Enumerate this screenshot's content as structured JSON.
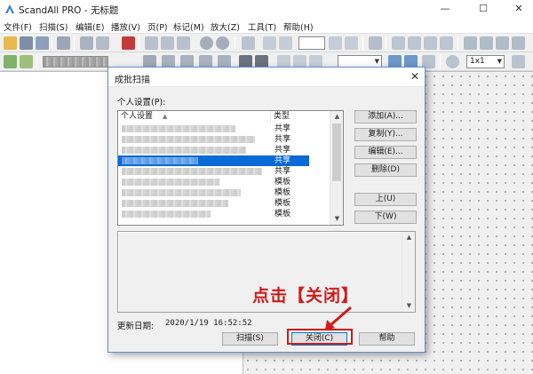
{
  "app": {
    "title": "ScandAll PRO - 无标题",
    "window_controls": {
      "minimize": "—",
      "maximize": "☐",
      "close": "✕"
    }
  },
  "menu": [
    "文件(F)",
    "扫描(S)",
    "编辑(E)",
    "播放(V)",
    "页(P)",
    "标记(M)",
    "放大(Z)",
    "工具(T)",
    "帮助(H)"
  ],
  "toolbar": {
    "zoom_value": "1x1"
  },
  "dialog": {
    "title": "成批扫描",
    "close_glyph": "✕",
    "settings_label": "个人设置(P):",
    "columns": {
      "name": "个人设置",
      "type": "类型"
    },
    "rows": [
      {
        "type": "共享",
        "selected": false
      },
      {
        "type": "共享",
        "selected": false
      },
      {
        "type": "共享",
        "selected": false
      },
      {
        "type": "共享",
        "selected": true
      },
      {
        "type": "共享",
        "selected": false
      },
      {
        "type": "模板",
        "selected": false
      },
      {
        "type": "模板",
        "selected": false
      },
      {
        "type": "模板",
        "selected": false
      },
      {
        "type": "模板",
        "selected": false
      }
    ],
    "buttons": {
      "add": "添加(A)...",
      "copy": "复制(Y)...",
      "edit": "编辑(E)...",
      "delete": "删除(D)",
      "up": "上(U)",
      "down": "下(W)",
      "scan": "扫描(S)",
      "close": "关闭(C)",
      "help": "帮助"
    },
    "updated_label": "更新日期:",
    "updated_value": "2020/1/19 16:52:52"
  },
  "annotation": {
    "text": "点击【关闭】",
    "color": "#d11a1a"
  },
  "colors": {
    "selection": "#0a6ad6",
    "focus_border": "#0078d7",
    "dialog_border": "#5a8fd8"
  }
}
